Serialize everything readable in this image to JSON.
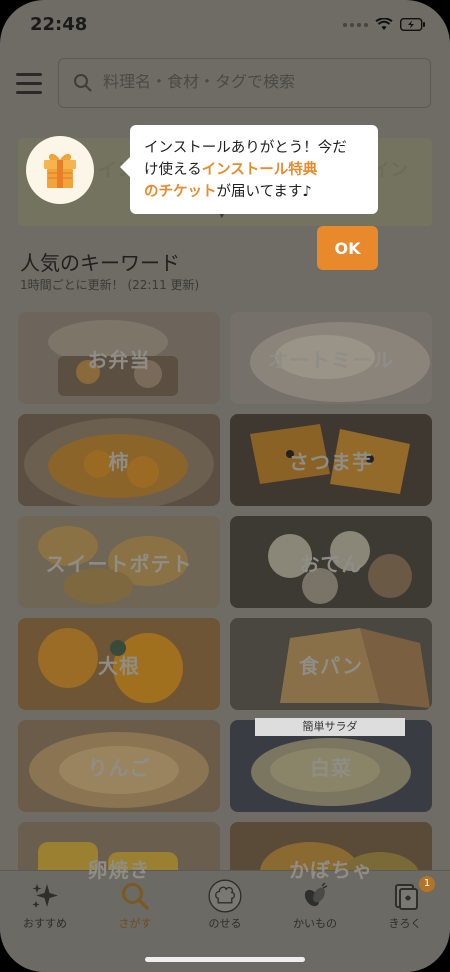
{
  "status_bar": {
    "time": "22:48"
  },
  "search": {
    "placeholder": "料理名・食材・タグで検索"
  },
  "banner": {
    "text": "インストール",
    "text_right": "イン"
  },
  "tooltip": {
    "line1": "インストールありがとう！今だ",
    "line2_prefix": "け使える",
    "highlight1": "インストール特典",
    "highlight2": "のチケット",
    "suffix": "が届いてます♪"
  },
  "ok_button": {
    "label": "OK"
  },
  "keywords": {
    "title": "人気のキーワード",
    "subtitle": "1時間ごとに更新！ (22:11 更新)",
    "items": [
      {
        "label": "お弁当"
      },
      {
        "label": "オートミール"
      },
      {
        "label": "柿"
      },
      {
        "label": "さつま芋"
      },
      {
        "label": "スイートポテト"
      },
      {
        "label": "おでん"
      },
      {
        "label": "大根"
      },
      {
        "label": "食パン"
      },
      {
        "label": "りんご"
      },
      {
        "label": "白菜"
      },
      {
        "label": "卵焼き"
      },
      {
        "label": "かぼちゃ"
      }
    ],
    "salad_tag": "簡単サラダ"
  },
  "bottom_nav": {
    "items": [
      {
        "label": "おすすめ",
        "icon": "sparkle-icon"
      },
      {
        "label": "さがす",
        "icon": "search-icon"
      },
      {
        "label": "のせる",
        "icon": "chef-hat-icon"
      },
      {
        "label": "かいもの",
        "icon": "vegetables-icon"
      },
      {
        "label": "きろく",
        "icon": "card-icon"
      }
    ],
    "badge": "1"
  },
  "colors": {
    "accent": "#e8892c",
    "overlay": "#6e6c65"
  }
}
